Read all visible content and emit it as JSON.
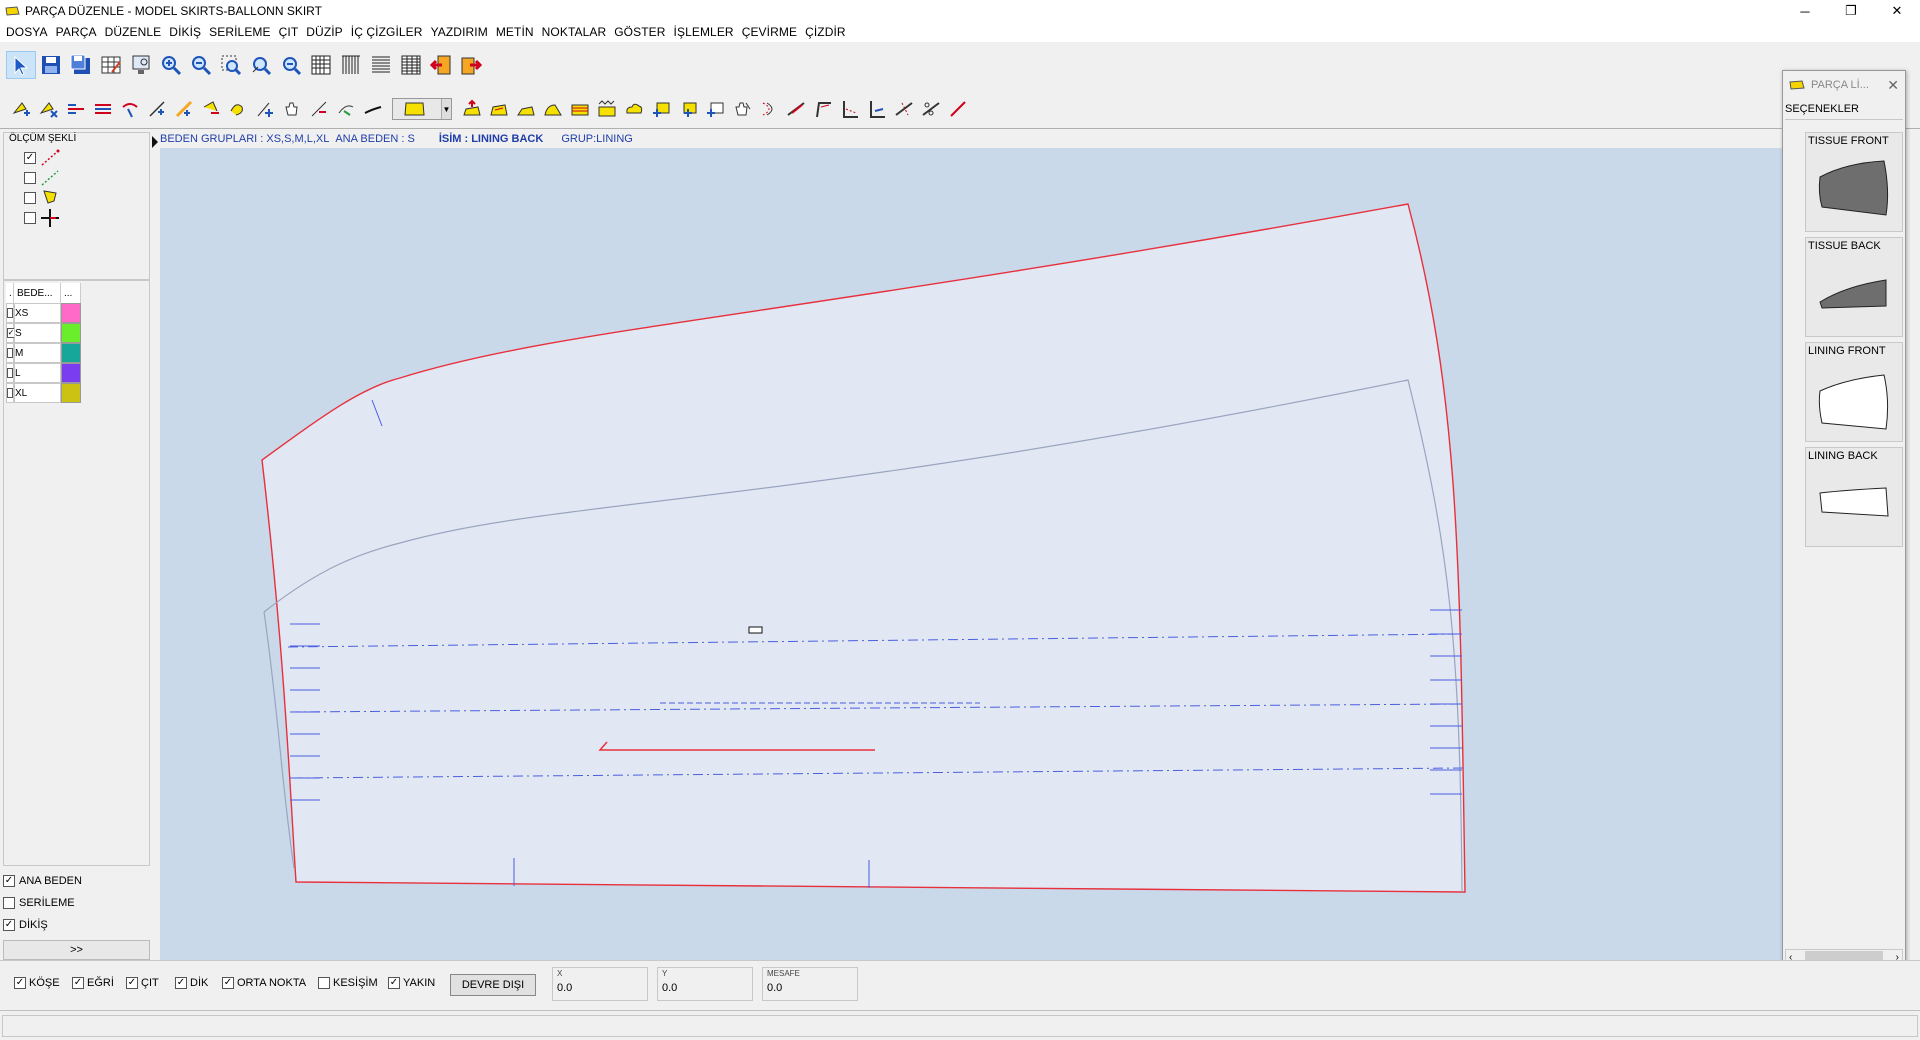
{
  "window": {
    "title": "PARÇA DÜZENLE - MODEL SKIRTS-BALLONN SKIRT",
    "controls": [
      "─",
      "❐",
      "✕"
    ]
  },
  "menu": [
    "DOSYA",
    "PARÇA",
    "DÜZENLE",
    "DİKİŞ",
    "SERİLEME",
    "ÇIT",
    "DÜZİP",
    "İÇ ÇİZGİLER",
    "YAZDIRIM",
    "METİN",
    "NOKTALAR",
    "GÖSTER",
    "İŞLEMLER",
    "ÇEVİRME",
    "ÇİZDİR"
  ],
  "left_panel": {
    "measure_title": "ÖLÇÜM ŞEKLİ",
    "measure_options": [
      {
        "checked": true,
        "icon": "red-dashed-line-icon"
      },
      {
        "checked": false,
        "icon": "green-dashed-line-icon"
      },
      {
        "checked": false,
        "icon": "yellow-shape-icon"
      },
      {
        "checked": false,
        "icon": "crosshair-icon"
      }
    ],
    "size_table": {
      "headers": [
        ".",
        "BEDE...",
        "..."
      ],
      "rows": [
        {
          "name": "XS",
          "checked": false,
          "color": "#ff69c8"
        },
        {
          "name": "S",
          "checked": true,
          "color": "#6aed2a"
        },
        {
          "name": "M",
          "checked": false,
          "color": "#16a69a"
        },
        {
          "name": "L",
          "checked": false,
          "color": "#7a3df0"
        },
        {
          "name": "XL",
          "checked": false,
          "color": "#cbc214"
        }
      ]
    },
    "bottom_options": [
      {
        "label": "ANA BEDEN",
        "checked": true
      },
      {
        "label": "SERİLEME",
        "checked": false
      },
      {
        "label": "DİKİŞ",
        "checked": true
      }
    ],
    "expand_label": ">>"
  },
  "canvas": {
    "size_groups": "BEDEN GRUPLARI : XS,S,M,L,XL",
    "main_size": "ANA BEDEN :  S",
    "name": "İSİM : LINING BACK",
    "group": "GRUP:LINING",
    "pattern_colors": {
      "outline": "#e8303c",
      "inner": "#9aa4bf",
      "grain": "#4a5ee0"
    }
  },
  "snap_options": [
    {
      "label": "KÖŞE",
      "checked": true
    },
    {
      "label": "EĞRİ",
      "checked": true
    },
    {
      "label": "ÇIT",
      "checked": true
    },
    {
      "label": "DİK",
      "checked": true
    },
    {
      "label": "ORTA NOKTA",
      "checked": true
    },
    {
      "label": "KESİŞİM",
      "checked": false
    },
    {
      "label": "YAKIN",
      "checked": true
    }
  ],
  "disable_button": "DEVRE DIŞI",
  "coords": {
    "x_label": "X",
    "x_value": "0.0",
    "y_label": "Y",
    "y_value": "0.0",
    "dist_label": "MESAFE",
    "dist_value": "0.0"
  },
  "pieces_panel": {
    "title": "PARÇA Lİ...",
    "options_label": "SEÇENEKLER",
    "pieces": [
      {
        "name": "TISSUE FRONT",
        "fill": "#6e6e6e"
      },
      {
        "name": "TISSUE BACK",
        "fill": "#6e6e6e"
      },
      {
        "name": "LINING FRONT",
        "fill": "#ffffff"
      },
      {
        "name": "LINING BACK",
        "fill": "#ffffff"
      }
    ]
  }
}
